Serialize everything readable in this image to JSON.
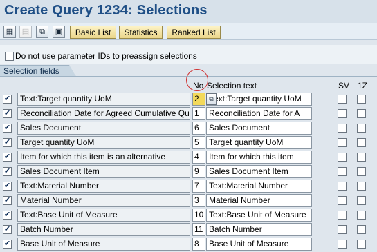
{
  "window": {
    "title": "Create Query 1234: Selections"
  },
  "toolbar": {
    "icons": [
      "table-icon",
      "document-icon",
      "hierarchy-icon",
      "screen-icon"
    ],
    "buttons": [
      "Basic List",
      "Statistics",
      "Ranked List"
    ]
  },
  "param": {
    "label": "Do not use parameter IDs to preassign selections",
    "checked": false
  },
  "group": {
    "tab_label": "Selection fields"
  },
  "columns": {
    "no": "No",
    "selection_text": "Selection text",
    "sv": "SV",
    "z": "1Z"
  },
  "rows": [
    {
      "checked": true,
      "field": "Text:Target quantity UoM",
      "no": "2",
      "text": "Text:Target quantity UoM"
    },
    {
      "checked": true,
      "field": "Reconciliation Date for Agreed Cumulative Qu",
      "no": "1",
      "text": "Reconciliation Date for A"
    },
    {
      "checked": true,
      "field": "Sales Document",
      "no": "6",
      "text": "Sales Document"
    },
    {
      "checked": true,
      "field": "Target quantity UoM",
      "no": "5",
      "text": "Target quantity UoM"
    },
    {
      "checked": true,
      "field": "Item for which this item is an alternative",
      "no": "4",
      "text": "Item for which this item"
    },
    {
      "checked": true,
      "field": "Sales Document Item",
      "no": "9",
      "text": "Sales Document Item"
    },
    {
      "checked": true,
      "field": "Text:Material Number",
      "no": "7",
      "text": "Text:Material Number"
    },
    {
      "checked": true,
      "field": "Material Number",
      "no": "3",
      "text": "Material Number"
    },
    {
      "checked": true,
      "field": "Text:Base Unit of Measure",
      "no": "10",
      "text": "Text:Base Unit of Measure"
    },
    {
      "checked": true,
      "field": "Batch Number",
      "no": "11",
      "text": "Batch Number"
    },
    {
      "checked": true,
      "field": "Base Unit of Measure",
      "no": "8",
      "text": "Base Unit of Measure"
    }
  ],
  "colors": {
    "title": "#1f4f86",
    "active_field": "#f3d95a",
    "annotation": "#d03030"
  }
}
